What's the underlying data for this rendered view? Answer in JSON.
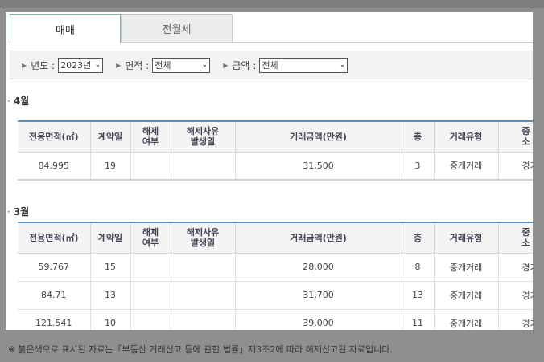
{
  "tabs": [
    {
      "label": "매매",
      "active": true
    },
    {
      "label": "전월세",
      "active": false
    }
  ],
  "filters": {
    "year_label": "년도 :",
    "year_value": "2023년",
    "area_label": "면적 :",
    "area_value": "전체",
    "amount_label": "금액 :",
    "amount_value": "전체"
  },
  "headers": {
    "area": "전용면적(㎡)",
    "contract_day": "계약일",
    "cancel_1": "해제",
    "cancel_2": "여부",
    "cancel_date_1": "해제사유",
    "cancel_date_2": "발생일",
    "price": "거래금액(만원)",
    "floor": "층",
    "trade_type": "거래유형",
    "broker_1": "중",
    "broker_2": "소"
  },
  "sections": [
    {
      "month": "4월",
      "rows": [
        {
          "area": "84.995",
          "day": "19",
          "cancel": "",
          "cancel_date": "",
          "price": "31,500",
          "floor": "3",
          "type": "중개거래",
          "broker": "경기"
        }
      ]
    },
    {
      "month": "3월",
      "rows": [
        {
          "area": "59.767",
          "day": "15",
          "cancel": "",
          "cancel_date": "",
          "price": "28,000",
          "floor": "8",
          "type": "중개거래",
          "broker": "경기"
        },
        {
          "area": "84.71",
          "day": "13",
          "cancel": "",
          "cancel_date": "",
          "price": "31,700",
          "floor": "13",
          "type": "중개거래",
          "broker": "경기"
        },
        {
          "area": "121.541",
          "day": "10",
          "cancel": "",
          "cancel_date": "",
          "price": "39,000",
          "floor": "11",
          "type": "중개거래",
          "broker": "경기"
        }
      ]
    }
  ],
  "footnote": {
    "mark": "※",
    "text": "붉은색으로 표시된 자료는「부동산 거래신고 등에 관한 법률」제3조2에 따라 해제신고된 자료입니다."
  }
}
